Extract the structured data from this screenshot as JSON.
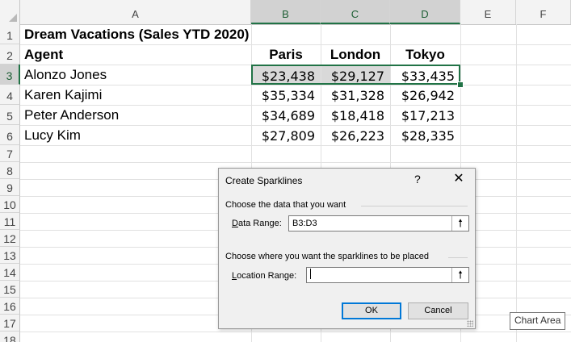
{
  "columns": [
    "A",
    "B",
    "C",
    "D",
    "E",
    "F"
  ],
  "rows": [
    "1",
    "2",
    "3",
    "4",
    "5",
    "6",
    "7",
    "8",
    "9",
    "10",
    "11",
    "12",
    "13",
    "14",
    "15",
    "16",
    "17",
    "18"
  ],
  "sheet": {
    "title": "Dream Vacations (Sales YTD 2020)",
    "header": {
      "agent": "Agent",
      "c1": "Paris",
      "c2": "London",
      "c3": "Tokyo"
    },
    "agents": [
      {
        "name": "Alonzo Jones",
        "paris": "$23,438",
        "london": "$29,127",
        "tokyo": "$33,435"
      },
      {
        "name": "Karen Kajimi",
        "paris": "$35,334",
        "london": "$31,328",
        "tokyo": "$26,942"
      },
      {
        "name": "Peter Anderson",
        "paris": "$34,689",
        "london": "$18,418",
        "tokyo": "$17,213"
      },
      {
        "name": "Lucy Kim",
        "paris": "$27,809",
        "london": "$26,223",
        "tokyo": "$28,335"
      }
    ]
  },
  "dialog": {
    "title": "Create Sparklines",
    "help": "?",
    "close": "✕",
    "data_group": "Choose the data that you want",
    "data_range_label_ul": "D",
    "data_range_label_rest": "ata Range:",
    "data_range_value": "B3:D3",
    "location_group": "Choose where you want the sparklines to be placed",
    "location_label_ul": "L",
    "location_label_rest": "ocation Range:",
    "location_value": "",
    "range_button_icon": "🠕",
    "ok": "OK",
    "cancel": "Cancel"
  },
  "tooltip": "Chart Area",
  "colors": {
    "accent": "#217346",
    "selection": "#d9d9d9",
    "dialog_bg": "#f0f0f0",
    "default_button": "#0078d7"
  }
}
